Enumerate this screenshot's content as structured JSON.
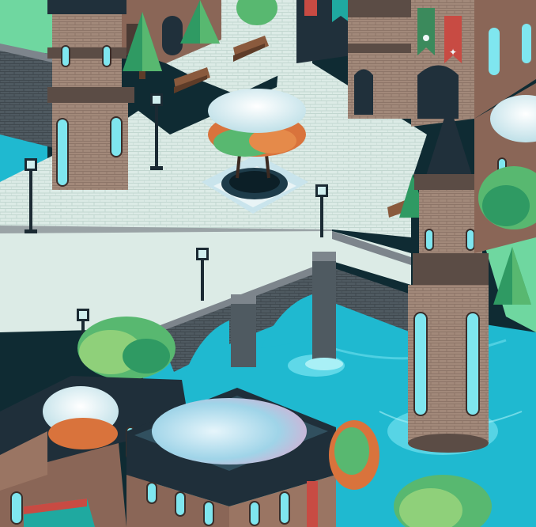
{
  "scene": {
    "kind": "isometric town game view",
    "palette": {
      "plaza": "#dcebe6",
      "plaza_line": "#bcd3cc",
      "stone_wall": "#7d858c",
      "brick_wall": "#4f5a61",
      "water": "#1fb9d0",
      "water_light": "#6fe0ee",
      "grass": "#6fd7a0",
      "tower_roof": "#20303b",
      "tower_stone": "#a2897a",
      "tower_band": "#5b4c45",
      "window": "#7fe6ef",
      "lamp": "#1b2a33",
      "tree_dark": "#2f9a63",
      "tree_mid": "#58b870",
      "tree_light": "#8fd07a",
      "snow": "#eef6f7",
      "orange_leaf": "#d9733c",
      "banner_green": "#3b8a5c",
      "banner_red": "#c84b43",
      "banner_teal": "#1fa9a0",
      "house_wall": "#8a6657",
      "roof_dark": "#1f2f3a"
    },
    "icons": [
      "street-lamp-icon",
      "bench-icon",
      "conifer-tree-icon",
      "round-tree-icon",
      "banner-flag-icon",
      "tower-icon"
    ]
  }
}
